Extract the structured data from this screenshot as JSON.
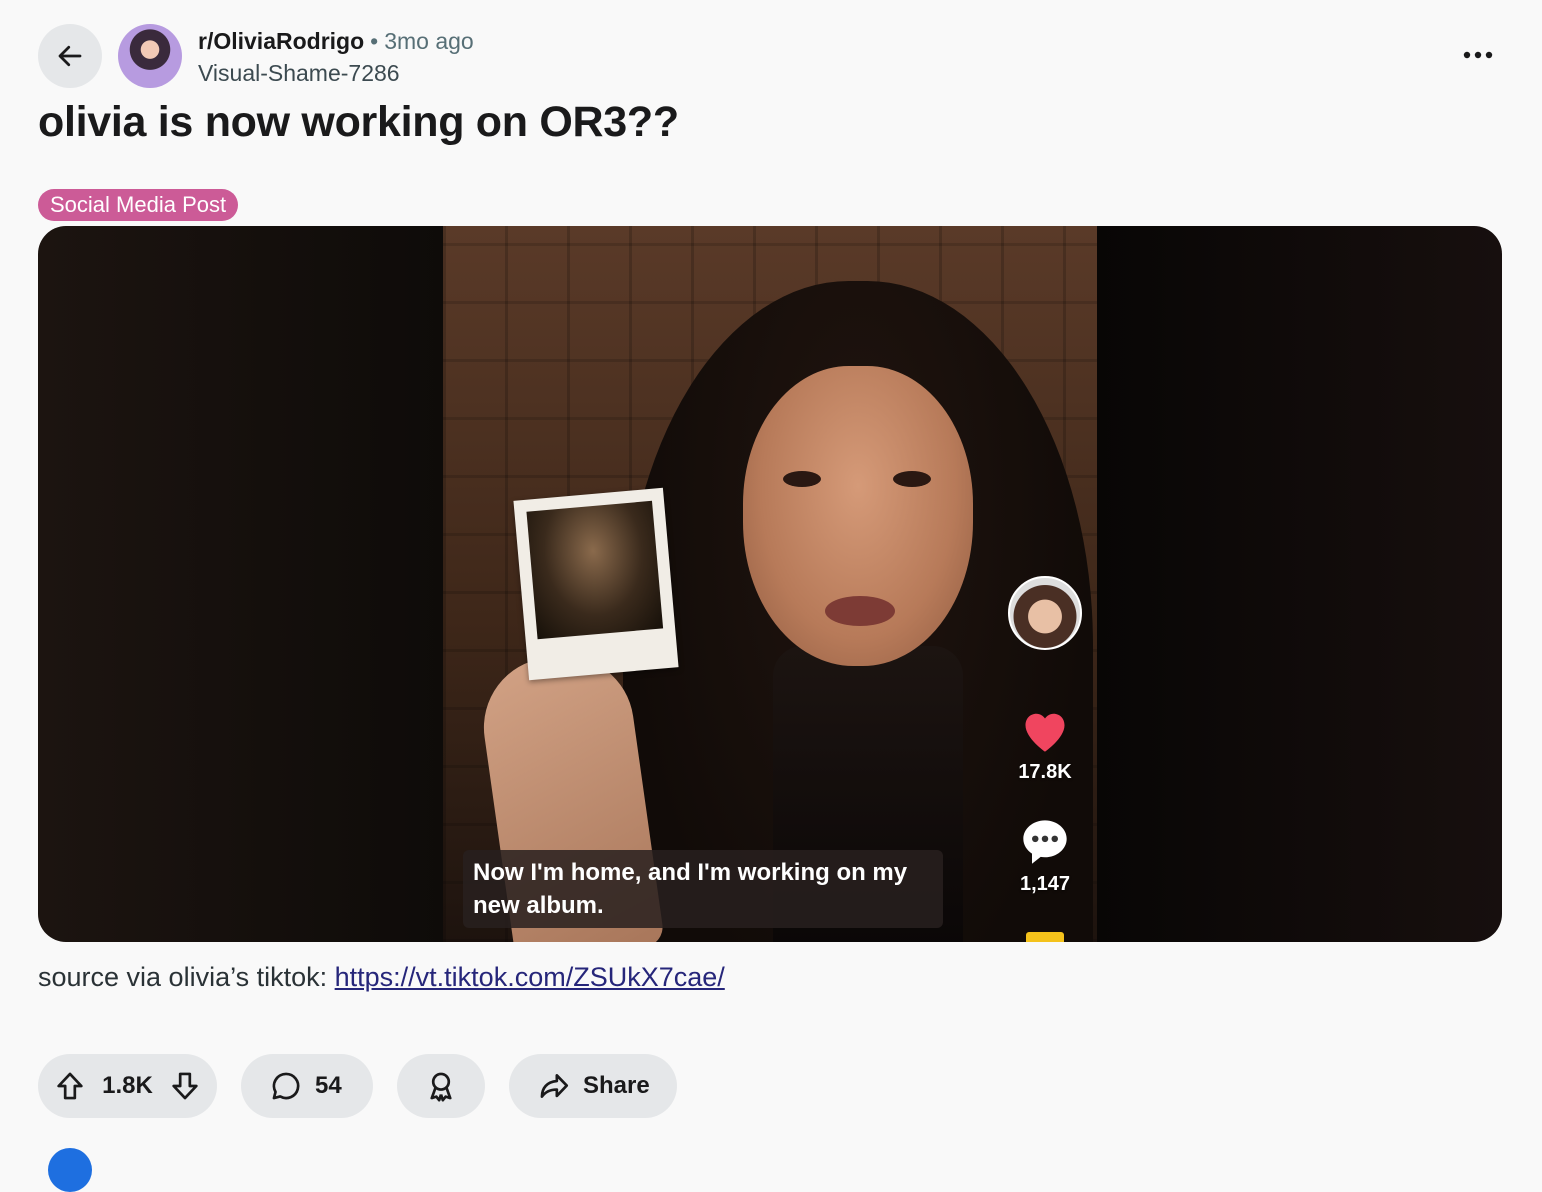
{
  "header": {
    "subreddit": "r/OliviaRodrigo",
    "separator": "•",
    "time_ago": "3mo ago",
    "author": "Visual-Shame-7286"
  },
  "post": {
    "title": "olivia is now working on OR3??",
    "flair": "Social Media Post",
    "body_prefix": "source via olivia’s tiktok:",
    "link_text": "https://vt.tiktok.com/ZSUkX7cae/"
  },
  "video": {
    "likes": "17.8K",
    "comments": "1,147",
    "caption": "Now I'm home, and I'm working on my new album."
  },
  "actions": {
    "votes": "1.8K",
    "comments": "54",
    "share_label": "Share"
  },
  "colors": {
    "flair_bg": "#cc5b97",
    "like_heart": "#f0455f",
    "link": "#26267a",
    "pill_bg": "#e5e7e9"
  },
  "icons": [
    "back-arrow-icon",
    "more-options-icon",
    "heart-icon",
    "comment-bubble-icon",
    "upvote-icon",
    "downvote-icon",
    "comment-icon",
    "award-icon",
    "share-icon"
  ]
}
